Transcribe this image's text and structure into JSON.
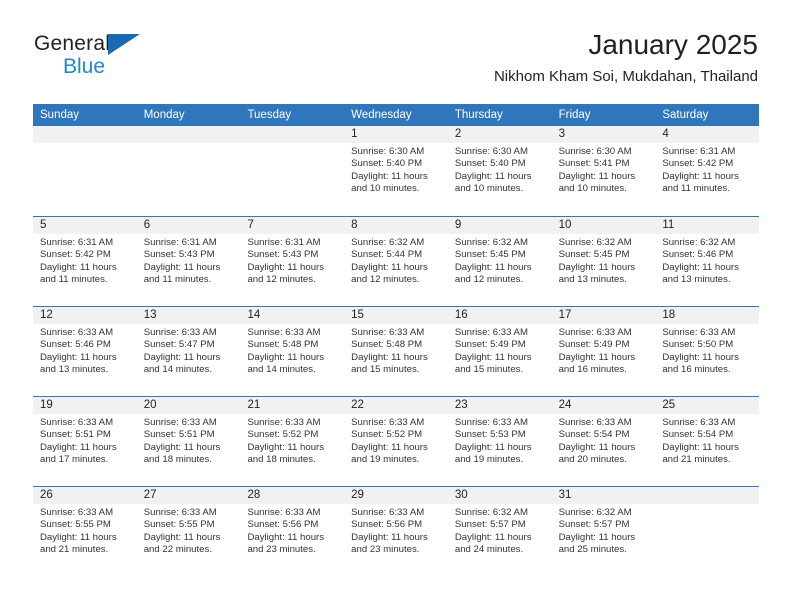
{
  "logo": {
    "word_top": "General",
    "word_bottom": "Blue",
    "triangle_color": "#1c69b3",
    "blue_text_color": "#2286d8"
  },
  "header": {
    "title": "January 2025",
    "subtitle": "Nikhom Kham Soi, Mukdahan, Thailand"
  },
  "theme": {
    "header_blue": "#2f76bc",
    "day_band_gray": "#f1f1f1",
    "text_color": "#231f20"
  },
  "calendar": {
    "weekdays": [
      "Sunday",
      "Monday",
      "Tuesday",
      "Wednesday",
      "Thursday",
      "Friday",
      "Saturday"
    ],
    "weeks": [
      [
        {
          "day": "",
          "empty": true
        },
        {
          "day": "",
          "empty": true
        },
        {
          "day": "",
          "empty": true
        },
        {
          "day": "1",
          "sunrise": "Sunrise: 6:30 AM",
          "sunset": "Sunset: 5:40 PM",
          "daylight": "Daylight: 11 hours and 10 minutes."
        },
        {
          "day": "2",
          "sunrise": "Sunrise: 6:30 AM",
          "sunset": "Sunset: 5:40 PM",
          "daylight": "Daylight: 11 hours and 10 minutes."
        },
        {
          "day": "3",
          "sunrise": "Sunrise: 6:30 AM",
          "sunset": "Sunset: 5:41 PM",
          "daylight": "Daylight: 11 hours and 10 minutes."
        },
        {
          "day": "4",
          "sunrise": "Sunrise: 6:31 AM",
          "sunset": "Sunset: 5:42 PM",
          "daylight": "Daylight: 11 hours and 11 minutes."
        }
      ],
      [
        {
          "day": "5",
          "sunrise": "Sunrise: 6:31 AM",
          "sunset": "Sunset: 5:42 PM",
          "daylight": "Daylight: 11 hours and 11 minutes."
        },
        {
          "day": "6",
          "sunrise": "Sunrise: 6:31 AM",
          "sunset": "Sunset: 5:43 PM",
          "daylight": "Daylight: 11 hours and 11 minutes."
        },
        {
          "day": "7",
          "sunrise": "Sunrise: 6:31 AM",
          "sunset": "Sunset: 5:43 PM",
          "daylight": "Daylight: 11 hours and 12 minutes."
        },
        {
          "day": "8",
          "sunrise": "Sunrise: 6:32 AM",
          "sunset": "Sunset: 5:44 PM",
          "daylight": "Daylight: 11 hours and 12 minutes."
        },
        {
          "day": "9",
          "sunrise": "Sunrise: 6:32 AM",
          "sunset": "Sunset: 5:45 PM",
          "daylight": "Daylight: 11 hours and 12 minutes."
        },
        {
          "day": "10",
          "sunrise": "Sunrise: 6:32 AM",
          "sunset": "Sunset: 5:45 PM",
          "daylight": "Daylight: 11 hours and 13 minutes."
        },
        {
          "day": "11",
          "sunrise": "Sunrise: 6:32 AM",
          "sunset": "Sunset: 5:46 PM",
          "daylight": "Daylight: 11 hours and 13 minutes."
        }
      ],
      [
        {
          "day": "12",
          "sunrise": "Sunrise: 6:33 AM",
          "sunset": "Sunset: 5:46 PM",
          "daylight": "Daylight: 11 hours and 13 minutes."
        },
        {
          "day": "13",
          "sunrise": "Sunrise: 6:33 AM",
          "sunset": "Sunset: 5:47 PM",
          "daylight": "Daylight: 11 hours and 14 minutes."
        },
        {
          "day": "14",
          "sunrise": "Sunrise: 6:33 AM",
          "sunset": "Sunset: 5:48 PM",
          "daylight": "Daylight: 11 hours and 14 minutes."
        },
        {
          "day": "15",
          "sunrise": "Sunrise: 6:33 AM",
          "sunset": "Sunset: 5:48 PM",
          "daylight": "Daylight: 11 hours and 15 minutes."
        },
        {
          "day": "16",
          "sunrise": "Sunrise: 6:33 AM",
          "sunset": "Sunset: 5:49 PM",
          "daylight": "Daylight: 11 hours and 15 minutes."
        },
        {
          "day": "17",
          "sunrise": "Sunrise: 6:33 AM",
          "sunset": "Sunset: 5:49 PM",
          "daylight": "Daylight: 11 hours and 16 minutes."
        },
        {
          "day": "18",
          "sunrise": "Sunrise: 6:33 AM",
          "sunset": "Sunset: 5:50 PM",
          "daylight": "Daylight: 11 hours and 16 minutes."
        }
      ],
      [
        {
          "day": "19",
          "sunrise": "Sunrise: 6:33 AM",
          "sunset": "Sunset: 5:51 PM",
          "daylight": "Daylight: 11 hours and 17 minutes."
        },
        {
          "day": "20",
          "sunrise": "Sunrise: 6:33 AM",
          "sunset": "Sunset: 5:51 PM",
          "daylight": "Daylight: 11 hours and 18 minutes."
        },
        {
          "day": "21",
          "sunrise": "Sunrise: 6:33 AM",
          "sunset": "Sunset: 5:52 PM",
          "daylight": "Daylight: 11 hours and 18 minutes."
        },
        {
          "day": "22",
          "sunrise": "Sunrise: 6:33 AM",
          "sunset": "Sunset: 5:52 PM",
          "daylight": "Daylight: 11 hours and 19 minutes."
        },
        {
          "day": "23",
          "sunrise": "Sunrise: 6:33 AM",
          "sunset": "Sunset: 5:53 PM",
          "daylight": "Daylight: 11 hours and 19 minutes."
        },
        {
          "day": "24",
          "sunrise": "Sunrise: 6:33 AM",
          "sunset": "Sunset: 5:54 PM",
          "daylight": "Daylight: 11 hours and 20 minutes."
        },
        {
          "day": "25",
          "sunrise": "Sunrise: 6:33 AM",
          "sunset": "Sunset: 5:54 PM",
          "daylight": "Daylight: 11 hours and 21 minutes."
        }
      ],
      [
        {
          "day": "26",
          "sunrise": "Sunrise: 6:33 AM",
          "sunset": "Sunset: 5:55 PM",
          "daylight": "Daylight: 11 hours and 21 minutes."
        },
        {
          "day": "27",
          "sunrise": "Sunrise: 6:33 AM",
          "sunset": "Sunset: 5:55 PM",
          "daylight": "Daylight: 11 hours and 22 minutes."
        },
        {
          "day": "28",
          "sunrise": "Sunrise: 6:33 AM",
          "sunset": "Sunset: 5:56 PM",
          "daylight": "Daylight: 11 hours and 23 minutes."
        },
        {
          "day": "29",
          "sunrise": "Sunrise: 6:33 AM",
          "sunset": "Sunset: 5:56 PM",
          "daylight": "Daylight: 11 hours and 23 minutes."
        },
        {
          "day": "30",
          "sunrise": "Sunrise: 6:32 AM",
          "sunset": "Sunset: 5:57 PM",
          "daylight": "Daylight: 11 hours and 24 minutes."
        },
        {
          "day": "31",
          "sunrise": "Sunrise: 6:32 AM",
          "sunset": "Sunset: 5:57 PM",
          "daylight": "Daylight: 11 hours and 25 minutes."
        },
        {
          "day": "",
          "empty": true
        }
      ]
    ]
  }
}
